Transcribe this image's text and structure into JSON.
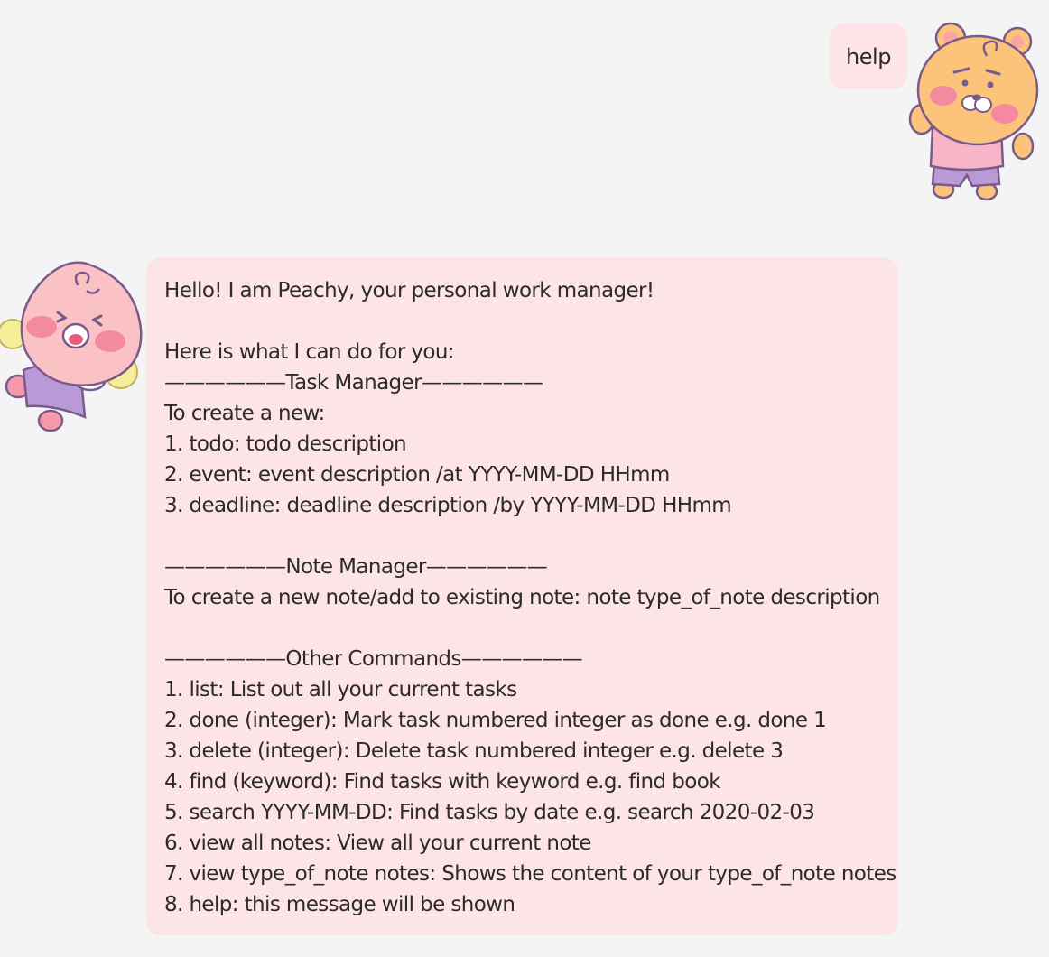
{
  "user_message": {
    "text": "help",
    "avatar_icon": "ryan-bear-character-icon"
  },
  "bot_message": {
    "avatar_icon": "apeach-peach-character-icon",
    "bubble_color": "#fde4e6",
    "lines": [
      "Hello! I am Peachy, your personal work manager!",
      "",
      "Here is what I can do for you:",
      "——————Task Manager——————",
      "To create a new:",
      "1. todo: todo description",
      "2. event: event description /at YYYY-MM-DD HHmm",
      "3. deadline: deadline description /by YYYY-MM-DD HHmm",
      "",
      "——————Note Manager——————",
      "To create a new note/add to existing note: note type_of_note description",
      "",
      "——————Other Commands——————",
      "1. list: List out all your current tasks",
      "2. done (integer): Mark task numbered integer as done e.g. done 1",
      "3. delete (integer): Delete task numbered integer e.g. delete 3",
      "4. find (keyword): Find tasks with keyword e.g. find book",
      "5. search YYYY-MM-DD: Find tasks by date e.g. search 2020-02-03",
      "6. view all notes: View all your current note",
      "7. view type_of_note notes: Shows the content of your type_of_note notes",
      "8. help: this message will be shown"
    ]
  },
  "colors": {
    "background": "#f4f4f4",
    "bubble": "#fde4e6",
    "text": "#2b2b2b"
  }
}
